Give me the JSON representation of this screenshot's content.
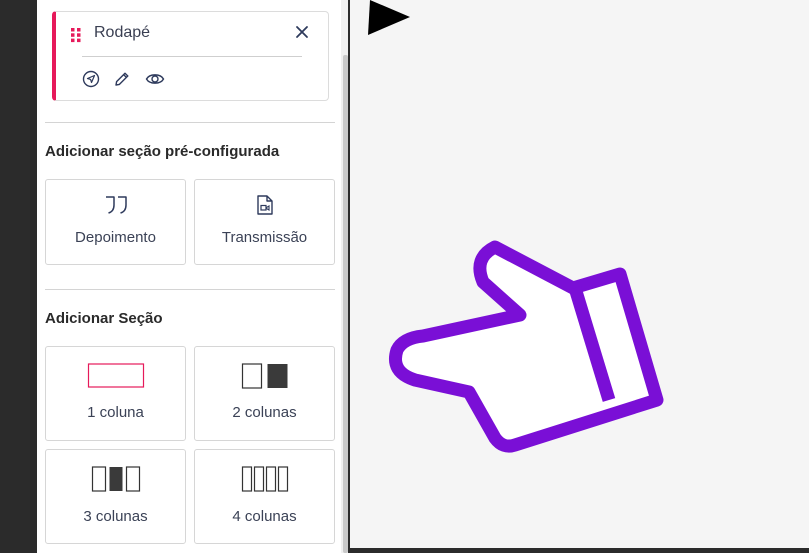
{
  "footer_card": {
    "title": "Rodapé",
    "accent_color": "#e6195a",
    "icons": [
      "send-icon",
      "pencil-icon",
      "eye-icon"
    ]
  },
  "preconfigured": {
    "heading": "Adicionar seção pré-configurada",
    "items": [
      {
        "label": "Depoimento",
        "icon": "quote-icon"
      },
      {
        "label": "Transmissão",
        "icon": "video-file-icon"
      }
    ]
  },
  "add_section": {
    "heading": "Adicionar Seção",
    "items": [
      {
        "label": "1 coluna",
        "icon": "one-column-icon"
      },
      {
        "label": "2 colunas",
        "icon": "two-columns-icon"
      },
      {
        "label": "3 colunas",
        "icon": "three-columns-icon"
      },
      {
        "label": "4 colunas",
        "icon": "four-columns-icon"
      }
    ]
  },
  "colors": {
    "accent": "#e6195a",
    "hand_outline": "#7a0fd6",
    "canvas_bg": "#f5f5f5"
  }
}
